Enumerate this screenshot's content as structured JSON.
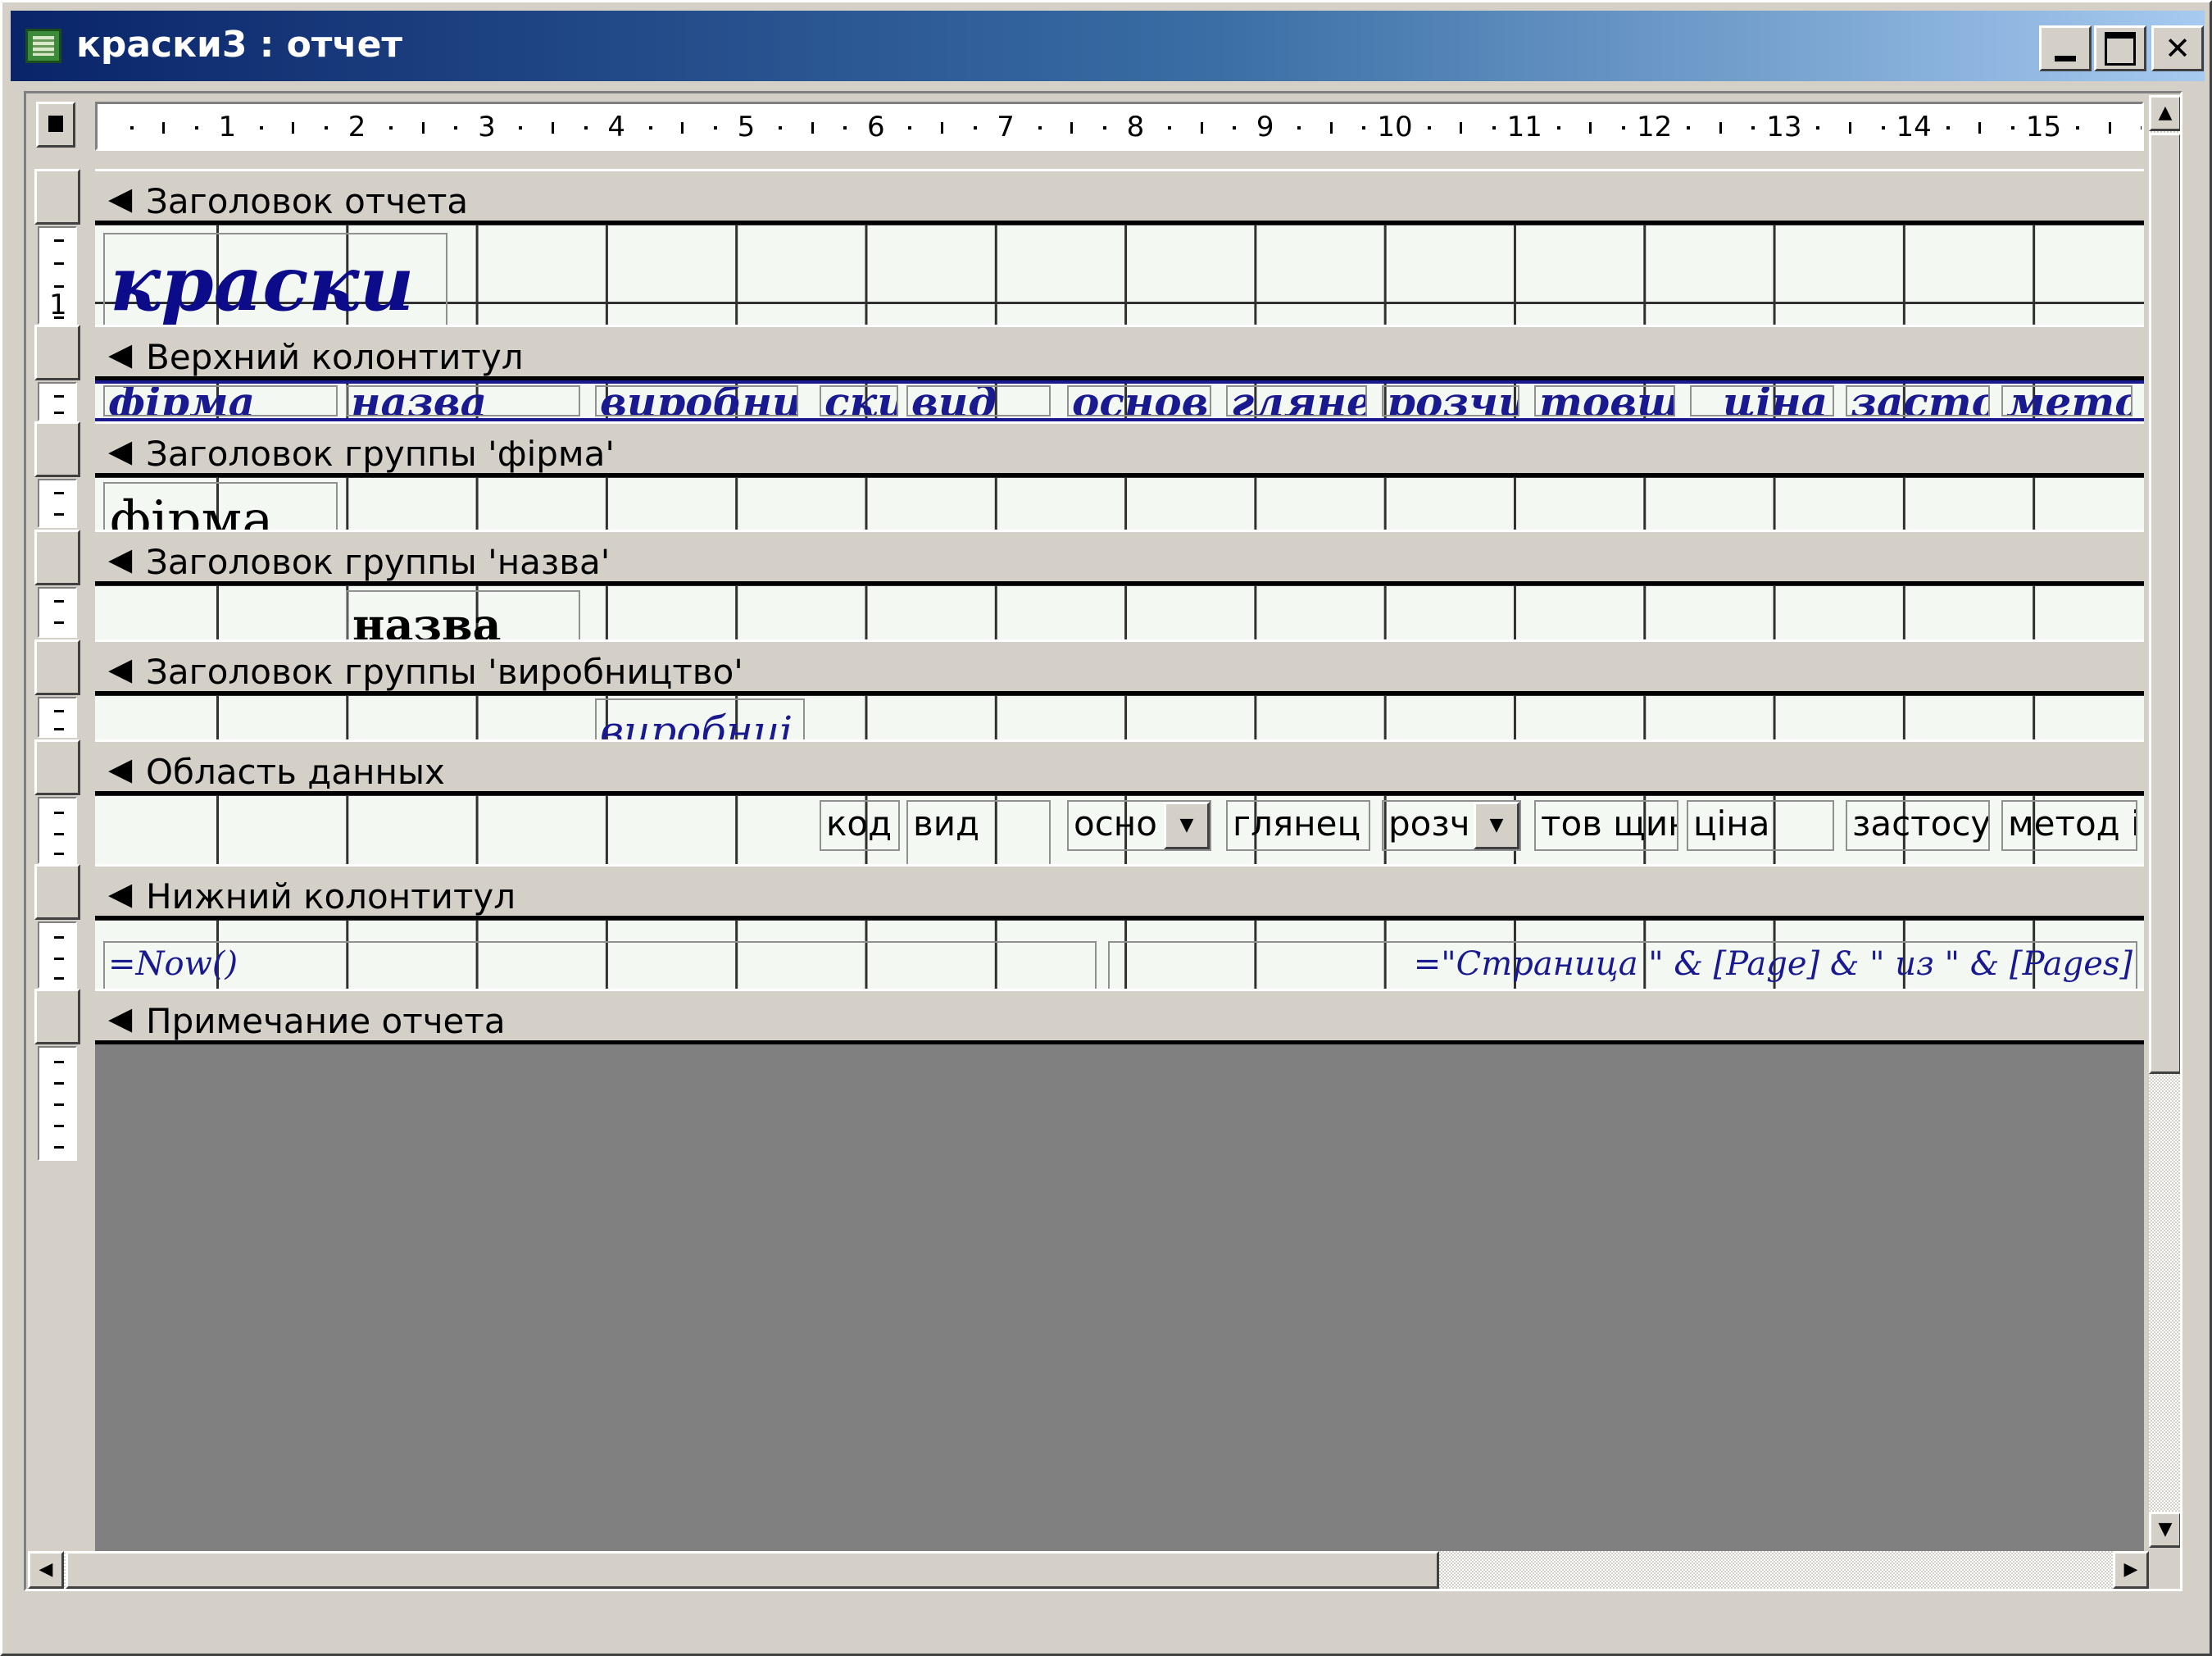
{
  "window": {
    "title": "краски3 : отчет",
    "buttons": {
      "minimize": "minimize-icon",
      "maximize": "maximize-icon",
      "close": "✕"
    }
  },
  "ruler": {
    "marks": [
      "1",
      "2",
      "3",
      "4",
      "5",
      "6",
      "7",
      "8",
      "9",
      "10",
      "11",
      "12",
      "13",
      "14",
      "15"
    ],
    "vertical_mark": "1"
  },
  "sections": {
    "report_header": "Заголовок отчета",
    "page_header": "Верхний колонтитул",
    "group_firma": "Заголовок группы 'фірма'",
    "group_nazva": "Заголовок группы 'назва'",
    "group_vyrobnytstvo": "Заголовок группы 'виробництво'",
    "detail": "Область данных",
    "page_footer": "Нижний колонтитул",
    "report_footer": "Примечание отчета"
  },
  "report_header": {
    "title_label": "краски"
  },
  "page_header": {
    "labels": [
      "фірма",
      "назва",
      "виробниі",
      "ски",
      "вид",
      "основі",
      "гляне.",
      "розчи",
      "товщ",
      "ціна",
      "засто",
      "мето"
    ]
  },
  "group_firma": {
    "field": "фірма"
  },
  "group_nazva": {
    "field": "назва"
  },
  "group_vyrobnytstvo": {
    "field": "виробниі"
  },
  "detail": {
    "fields": [
      "код",
      "вид",
      "осно",
      "глянец",
      "розч",
      "тов щин",
      "ціна",
      "застосу",
      "метод і"
    ]
  },
  "page_footer": {
    "now_expr": "=Now()",
    "page_expr": "=\"Страница \" & [Page] & \" из \" & [Pages]"
  },
  "icons": {
    "band_arrow": "band-arrow-icon",
    "combo_arrow": "▼",
    "scroll_up": "▲",
    "scroll_down": "▼",
    "scroll_left": "◀",
    "scroll_right": "▶"
  }
}
